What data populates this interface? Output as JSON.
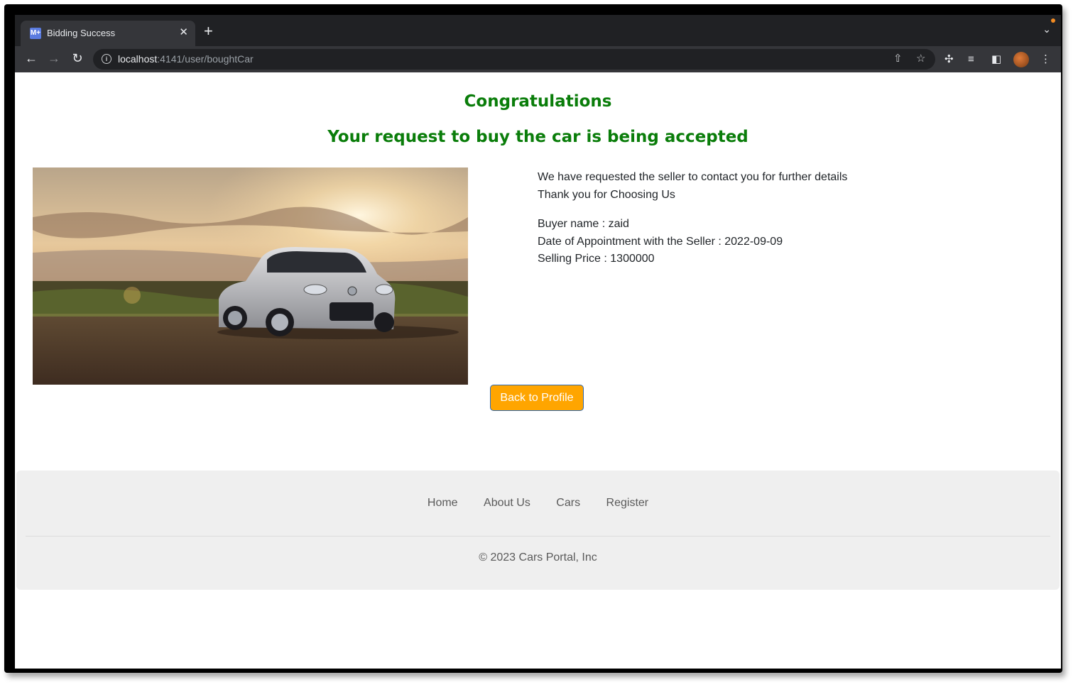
{
  "browser": {
    "tab_title": "Bidding Success",
    "tab_favicon": "M+",
    "url_host": "localhost",
    "url_path": ":4141/user/boughtCar"
  },
  "page": {
    "heading": "Congratulations",
    "subheading": "Your request to buy the car is being accepted",
    "image_alt": "car-photo",
    "message_line1": "We have requested the seller to contact you for further details",
    "message_line2": "Thank you for Choosing Us",
    "buyer_name": "Buyer name : zaid",
    "appointment_date": "Date of Appointment with the Seller : 2022-09-09",
    "selling_price": "Selling Price : 1300000",
    "back_button_label": "Back to Profile"
  },
  "footer": {
    "nav": [
      "Home",
      "About Us",
      "Cars",
      "Register"
    ],
    "copyright": "© 2023 Cars Portal, Inc"
  },
  "colors": {
    "heading_green": "#0a7d0a",
    "button_orange": "#ffa500",
    "footer_bg": "#efefef"
  }
}
